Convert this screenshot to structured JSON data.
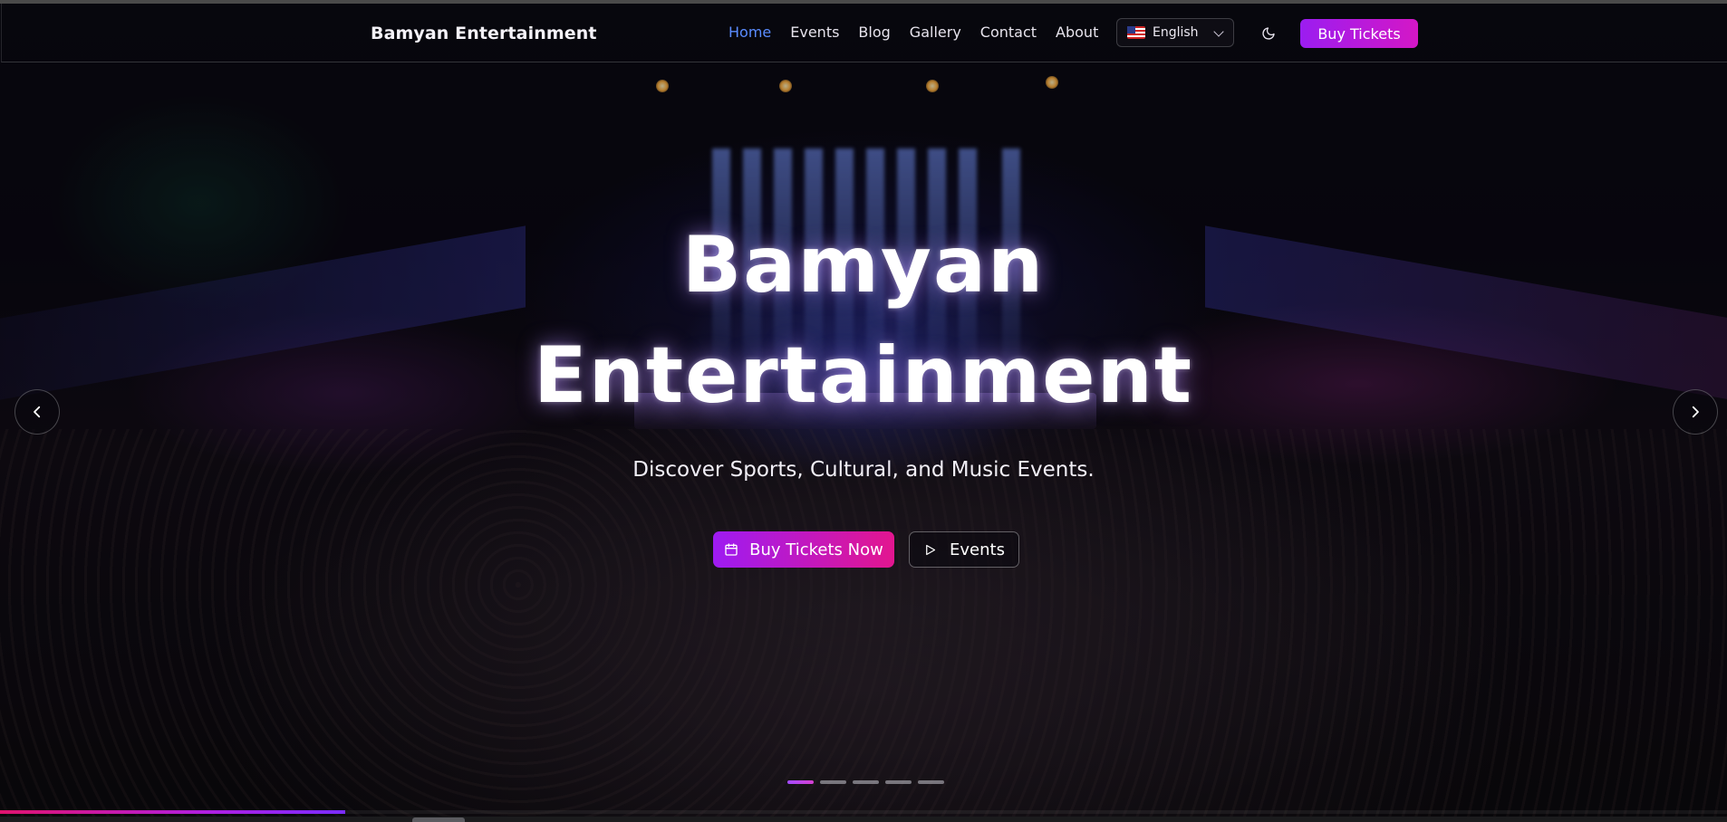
{
  "navbar": {
    "brand": "Bamyan Entertainment",
    "links": [
      {
        "label": "Home",
        "active": true
      },
      {
        "label": "Events",
        "active": false
      },
      {
        "label": "Blog",
        "active": false
      },
      {
        "label": "Gallery",
        "active": false
      },
      {
        "label": "Contact",
        "active": false
      },
      {
        "label": "About",
        "active": false
      }
    ],
    "language": {
      "flag_icon": "us-flag-icon",
      "selected": "English"
    },
    "theme_toggle_icon": "moon-icon",
    "buy_button": "Buy Tickets"
  },
  "hero": {
    "title_line1": "Bamyan",
    "title_line2": "Entertainment",
    "subtitle": "Discover Sports, Cultural, and Music Events.",
    "primary_button": {
      "icon": "calendar-icon",
      "label": "Buy Tickets Now"
    },
    "secondary_button": {
      "icon": "play-icon",
      "label": "Events"
    },
    "prev_icon": "chevron-left-icon",
    "next_icon": "chevron-right-icon"
  },
  "carousel": {
    "slide_count": 5,
    "active_index": 0,
    "progress_fraction": 0.2
  },
  "colors": {
    "accent_active_link": "#5a8cff",
    "button_gradient_start": "#9e1bf2",
    "button_gradient_end": "#e3168f"
  }
}
